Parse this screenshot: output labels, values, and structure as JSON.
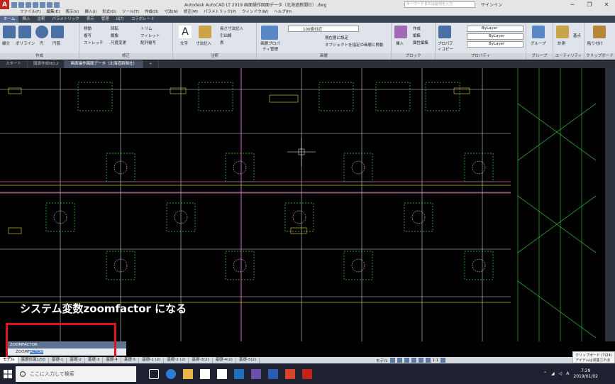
{
  "titlebar": {
    "title": "Autodesk AutoCAD LT 2019   画面操作図面データ（北海道新聞社）.dwg",
    "search_placeholder": "キーワードまたは語句を入力",
    "signin": "サインイン"
  },
  "menu": [
    "ファイル(F)",
    "編集(E)",
    "表示(V)",
    "挿入(I)",
    "形式(O)",
    "ツール(T)",
    "作成(D)",
    "寸法(N)",
    "修正(M)",
    "パラメトリック(P)",
    "ウィンドウ(W)",
    "ヘルプ(H)"
  ],
  "ribbon_tabs": [
    "ホーム",
    "挿入",
    "注釈",
    "パラメトリック",
    "表示",
    "管理",
    "出力",
    "コラボレート"
  ],
  "ribbon": {
    "draw_title": "作成",
    "modify_title": "修正",
    "annot_title": "注釈",
    "layer_title": "画層",
    "block_title": "ブロック",
    "prop_title": "プロパティ",
    "group_title": "グループ",
    "util_title": "ユーティリティ",
    "clip_title": "クリップボード",
    "line": "線分",
    "polyline": "ポリライン",
    "circle": "円",
    "arc": "円弧",
    "move": "移動",
    "rotate": "回転",
    "trim": "トリム",
    "copy": "複写",
    "mirror": "鏡像",
    "fillet": "フィレット",
    "stretch": "ストレッチ",
    "scale": "尺度変更",
    "array": "配列複写",
    "text": "文字",
    "dimension": "寸法記入",
    "linear": "長さ寸法記入",
    "leader": "引出線",
    "table": "表",
    "layer_prop": "画層プロパティ管理",
    "layer_name": "100樹付近",
    "set_current": "現在層に設定",
    "match_layer": "オブジェクトを指定の画層に移動",
    "insert": "挿入",
    "create": "作成",
    "edit": "編集",
    "edit_attr": "属性編集",
    "match_prop": "プロパティコピー",
    "bylayer": "ByLayer",
    "group": "グループ",
    "measure": "計測",
    "base": "基点",
    "paste": "貼り付け"
  },
  "file_tabs": [
    "スタート",
    "図面作成NO.2",
    "画面操作図面データ（北海道新聞社）"
  ],
  "annotation": "システム変数zoomfactor  になる",
  "command": {
    "history": "ZOOMFACTOR",
    "prompt_typed": "ZOOMF",
    "prompt_selected": "ACTOR"
  },
  "layout_tabs": [
    "モデル",
    "基礎伏図1/50",
    "基礎-1",
    "基礎-2",
    "基礎-3",
    "基礎-4",
    "基礎-5",
    "基礎-1 (2)",
    "基礎-2 (2)",
    "基礎-3(2)",
    "基礎-4(2)",
    "基礎-5(2)"
  ],
  "status": {
    "model": "モデル",
    "scale": "1:1"
  },
  "notification": {
    "title": "クリップボード (7/24)",
    "body": "アイテムは収集されました。"
  },
  "taskbar": {
    "search": "ここに入力して検索",
    "time": "7:29",
    "date": "2019/01/02",
    "ime": "A"
  }
}
